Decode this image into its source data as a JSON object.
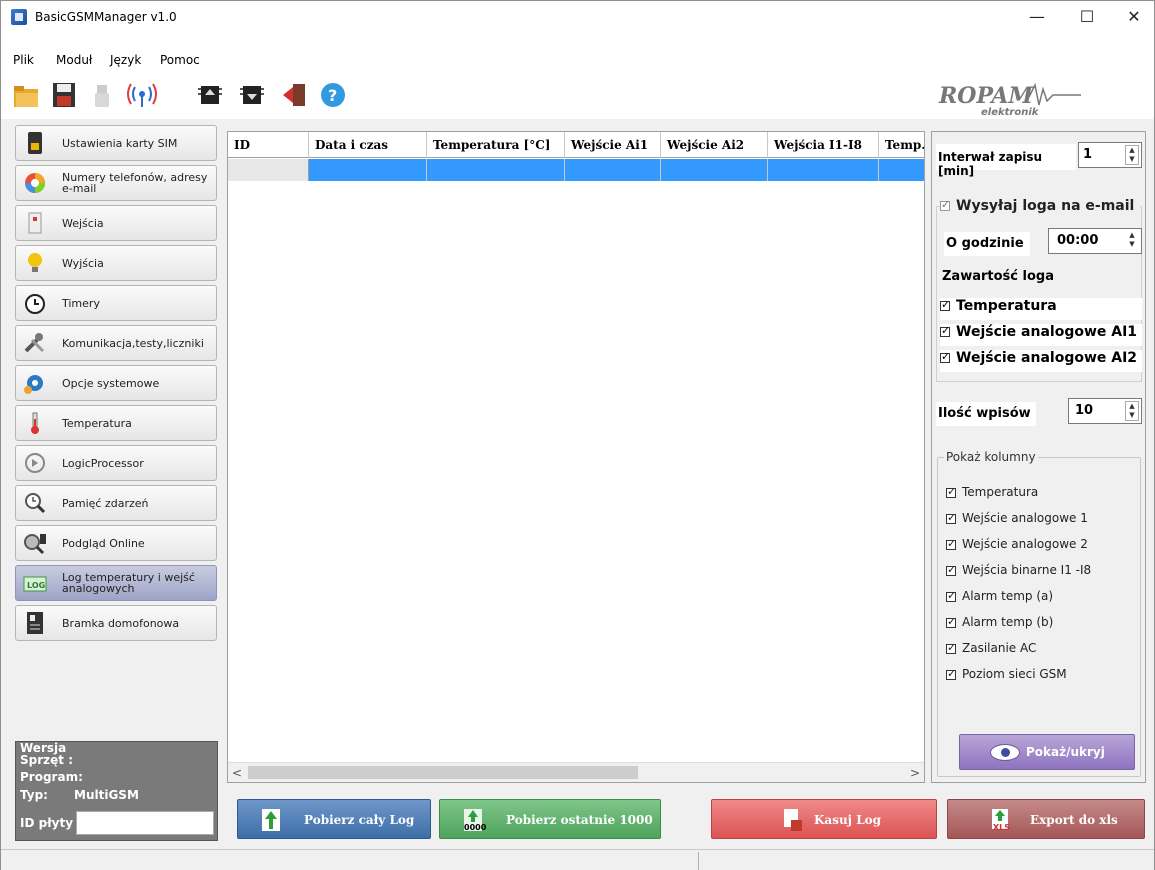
{
  "window": {
    "title": "BasicGSMManager v1.0",
    "min": "—",
    "max": "☐",
    "close": "✕"
  },
  "menu": [
    "Plik",
    "Moduł",
    "Język",
    "Pomoc"
  ],
  "toolbar": {
    "icons": [
      "folder-open-icon",
      "save-icon",
      "usb-icon",
      "signal-icon",
      "chip-upload-icon",
      "chip-download-icon",
      "exit-icon",
      "help-icon"
    ],
    "logo_text": "ROPAM",
    "logo_sub": "elektronik"
  },
  "sidebar": {
    "items": [
      {
        "label": "Ustawienia karty SIM",
        "icon": "sim-card-icon"
      },
      {
        "label": "Numery telefonów, adresy e-mail",
        "icon": "contacts-icon"
      },
      {
        "label": "Wejścia",
        "icon": "input-icon"
      },
      {
        "label": "Wyjścia",
        "icon": "bulb-icon"
      },
      {
        "label": "Timery",
        "icon": "clock-icon"
      },
      {
        "label": "Komunikacja,testy,liczniki",
        "icon": "tools-icon"
      },
      {
        "label": "Opcje systemowe",
        "icon": "gears-icon"
      },
      {
        "label": "Temperatura",
        "icon": "thermometer-icon"
      },
      {
        "label": "LogicProcessor",
        "icon": "logic-icon"
      },
      {
        "label": "Pamięć zdarzeń",
        "icon": "memory-icon"
      },
      {
        "label": "Podgląd Online",
        "icon": "online-icon"
      },
      {
        "label": "Log temperatury i wejść analogowych",
        "icon": "log-icon"
      },
      {
        "label": "Bramka domofonowa",
        "icon": "intercom-icon"
      }
    ],
    "active_index": 11,
    "version": {
      "title": "Wersja",
      "hw": "Sprzęt :",
      "prog": "Program:",
      "typ_label": "Typ:",
      "typ_value": "MultiGSM",
      "id_label": "ID płyty",
      "id_value": ""
    }
  },
  "table": {
    "columns": [
      "ID",
      "Data i czas",
      "Temperatura [°C]",
      "Wejście Ai1",
      "Wejście Ai2",
      "Wejścia I1-I8",
      "Temp."
    ],
    "scroll_left": "<",
    "scroll_right": ">"
  },
  "right": {
    "interval_label": "Interwał zapisu [min]",
    "interval_value": "1",
    "email_label": "Wysyłaj loga na e-mail",
    "at_label": "O godzinie",
    "at_value": "00:00",
    "content_label": "Zawartość loga",
    "content_items": [
      "Temperatura",
      "Wejście analogowe AI1",
      "Wejście analogowe AI2"
    ],
    "count_label": "Ilość wpisów",
    "count_value": "10",
    "columns_title": "Pokaż kolumny",
    "columns": [
      "Temperatura",
      "Wejście analogowe 1",
      "Wejście analogowe 2",
      "Wejścia binarne I1 -I8",
      "Alarm temp (a)",
      "Alarm temp (b)",
      "Zasilanie AC",
      "Poziom sieci GSM"
    ],
    "show_button": "Pokaż/ukryj"
  },
  "buttons": {
    "get_all": "Pobierz cały Log",
    "get_last": "Pobierz ostatnie 1000",
    "get_last_icon_text": "0000",
    "delete": "Kasuj Log",
    "export": "Export do xls",
    "export_icon_text": "XLS"
  }
}
